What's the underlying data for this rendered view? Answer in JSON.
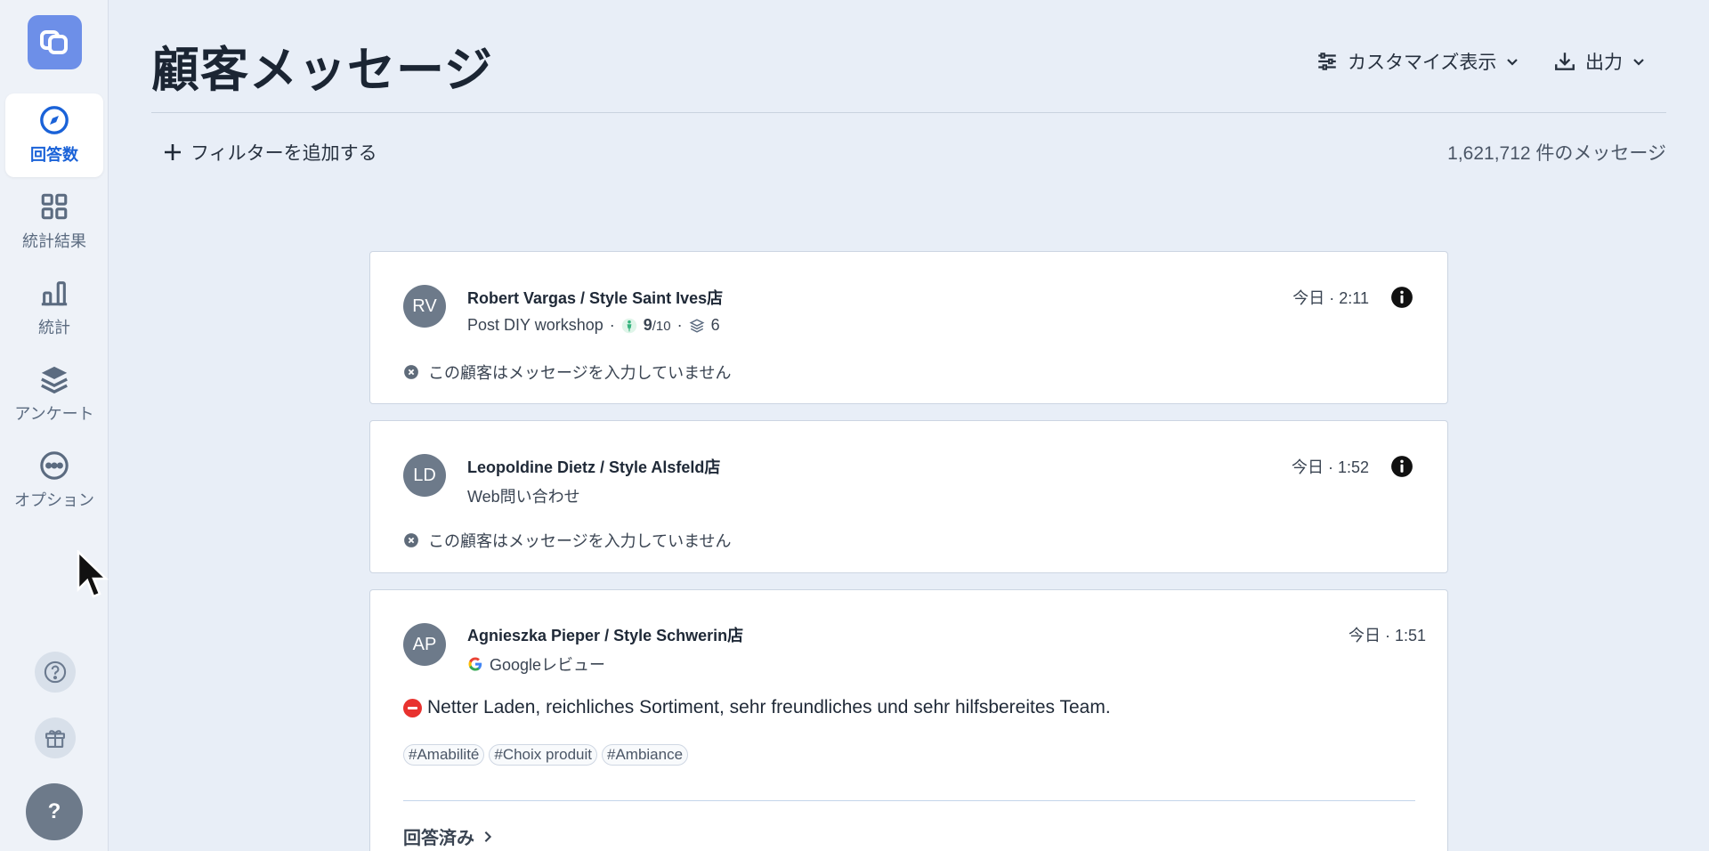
{
  "page": {
    "title": "顧客メッセージ"
  },
  "sidebar": {
    "items": [
      {
        "label": "回答数",
        "icon": "compass-icon",
        "active": true
      },
      {
        "label": "統計結果",
        "icon": "grid-icon"
      },
      {
        "label": "統計",
        "icon": "bar-chart-icon"
      },
      {
        "label": "アンケート",
        "icon": "layers-icon"
      },
      {
        "label": "オプション",
        "icon": "more-icon"
      }
    ],
    "help_label": "?"
  },
  "header": {
    "customize_label": "カスタマイズ表示",
    "export_label": "出力"
  },
  "toolbar": {
    "add_filter_label": "フィルターを追加する",
    "message_count": "1,621,712 件のメッセージ"
  },
  "colors": {
    "accent": "#1a62d8",
    "avatar": "#6d7a8a",
    "negative": "#e8322f",
    "score_green": "#36b37e"
  },
  "messages": [
    {
      "initials": "RV",
      "author": "Robert Vargas / Style Saint Ives店",
      "source": "Post DIY workshop",
      "score": "9",
      "score_max": "/10",
      "sep": "·",
      "layers_count": "6",
      "time": "今日 · 2:11",
      "empty_text": "この顧客はメッセージを入力していません"
    },
    {
      "initials": "LD",
      "author": "Leopoldine Dietz / Style Alsfeld店",
      "source": "Web問い合わせ",
      "time": "今日 · 1:52",
      "empty_text": "この顧客はメッセージを入力していません"
    },
    {
      "initials": "AP",
      "author": "Agnieszka Pieper / Style Schwerin店",
      "source": "Googleレビュー",
      "time": "今日 · 1:51",
      "text": "Netter Laden, reichliches Sortiment, sehr freundliches und sehr hilfsbereites Team.",
      "tags": [
        "#Amabilité",
        "#Choix produit",
        "#Ambiance"
      ],
      "answered_label": "回答済み"
    }
  ]
}
